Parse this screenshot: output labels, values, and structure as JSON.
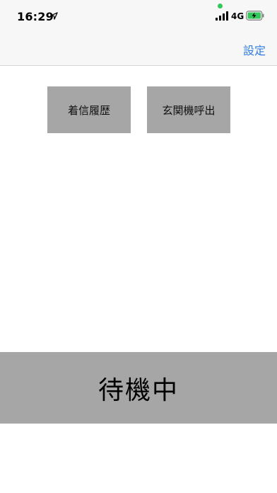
{
  "status_bar": {
    "time": "16:29",
    "network": "4G",
    "icons": [
      "location-arrow-icon",
      "signal-bars-icon",
      "battery-charging-icon"
    ],
    "colors": {
      "privacy_dot": "#34c759",
      "battery_fill": "#34c759"
    }
  },
  "nav": {
    "settings_label": "設定"
  },
  "actions": {
    "history_label": "着信履歴",
    "entrance_call_label": "玄関機呼出"
  },
  "status": {
    "label": "待機中"
  },
  "colors": {
    "accent": "#2f7de1",
    "button_bg": "#a6a6a6",
    "background": "#ffffff"
  }
}
